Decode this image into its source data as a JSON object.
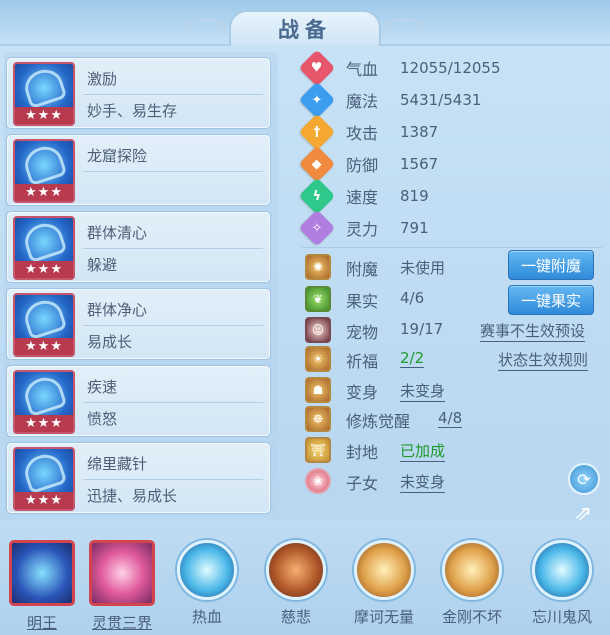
{
  "title": "战备",
  "skills": [
    {
      "name": "激励",
      "desc": "妙手、易生存",
      "stars": "★★★",
      "icon": "bow-icon"
    },
    {
      "name": "龙窟探险",
      "desc": "",
      "stars": "★★★",
      "icon": "dragon-crystal-icon"
    },
    {
      "name": "群体清心",
      "desc": "躲避",
      "stars": "★★★",
      "icon": "warrior-icon"
    },
    {
      "name": "群体净心",
      "desc": "易成长",
      "stars": "★★★",
      "icon": "fish-icon"
    },
    {
      "name": "疾速",
      "desc": "愤怒",
      "stars": "★★★",
      "icon": "wing-icon"
    },
    {
      "name": "绵里藏针",
      "desc": "迅捷、易成长",
      "stars": "★★★",
      "icon": "armor-icon"
    }
  ],
  "stats": [
    {
      "label": "气血",
      "value": "12055/12055",
      "color": "#e8566c",
      "icon": "heart-icon"
    },
    {
      "label": "魔法",
      "value": "5431/5431",
      "color": "#3c9cf0",
      "icon": "mana-icon"
    },
    {
      "label": "攻击",
      "value": "1387",
      "color": "#f4a832",
      "icon": "sword-icon"
    },
    {
      "label": "防御",
      "value": "1567",
      "color": "#f08a3e",
      "icon": "shield-icon"
    },
    {
      "label": "速度",
      "value": "819",
      "color": "#2ec88a",
      "icon": "lightning-icon"
    },
    {
      "label": "灵力",
      "value": "791",
      "color": "#b07ee0",
      "icon": "spirit-icon"
    }
  ],
  "extras": {
    "enchant": {
      "label": "附魔",
      "value": "未使用"
    },
    "fruit": {
      "label": "果实",
      "value": "4/6"
    },
    "pet": {
      "label": "宠物",
      "value": "19/17",
      "link": "赛事不生效预设"
    },
    "bless": {
      "label": "祈福",
      "value": "2/2",
      "link": "状态生效规则"
    },
    "transform": {
      "label": "变身",
      "value": "未变身"
    },
    "awaken": {
      "label": "修炼觉醒",
      "value": "4/8"
    },
    "land": {
      "label": "封地",
      "value": "已加成"
    },
    "child": {
      "label": "子女",
      "value": "未变身"
    }
  },
  "buttons": {
    "enchant": "一键附魔",
    "fruit": "一键果实"
  },
  "colors": {
    "green_status": "#1f9a2d",
    "button_blue": "#2f8ad9",
    "star_red": "#b73a4e"
  },
  "bottom_skills": [
    {
      "label": "明王",
      "icon": "orb-icon"
    },
    {
      "label": "灵贯三界",
      "icon": "pink-burst-icon"
    },
    {
      "label": "热血",
      "icon": "monk-icon"
    },
    {
      "label": "慈悲",
      "icon": "scroll-icon"
    },
    {
      "label": "摩诃无量",
      "icon": "warrior-icon"
    },
    {
      "label": "金刚不坏",
      "icon": "golden-buddha-icon"
    },
    {
      "label": "忘川鬼风",
      "icon": "wind-icon"
    }
  ]
}
